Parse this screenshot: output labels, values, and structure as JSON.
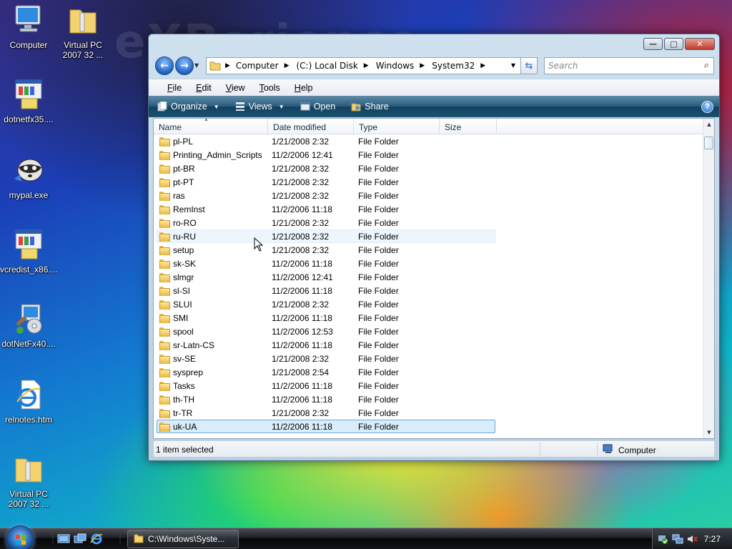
{
  "desktop": {
    "watermark": "eXPerience",
    "icons": [
      {
        "label": "Computer",
        "icon": "computer-icon"
      },
      {
        "label": "Virtual PC 2007 32 ...",
        "icon": "zip-folder-icon"
      },
      {
        "label": "dotnetfx35....",
        "icon": "installer-icon"
      },
      {
        "label": "mypal.exe",
        "icon": "raccoon-icon"
      },
      {
        "label": "vcredist_x86....",
        "icon": "installer-icon"
      },
      {
        "label": "dotNetFx40....",
        "icon": "setup-icon"
      },
      {
        "label": "relnotes.htm",
        "icon": "ie-document-icon"
      },
      {
        "label": "Virtual PC 2007 32 ...",
        "icon": "zip-folder-icon"
      }
    ]
  },
  "window": {
    "buttons": {
      "minimize": "—",
      "maximize": "□",
      "close": "✕"
    },
    "address": {
      "crumbs": [
        "Computer",
        "(C:) Local Disk",
        "Windows",
        "System32"
      ]
    },
    "search": {
      "placeholder": "Search"
    },
    "menu": [
      "File",
      "Edit",
      "View",
      "Tools",
      "Help"
    ],
    "toolbar": {
      "organize": "Organize",
      "views": "Views",
      "open": "Open",
      "share": "Share"
    },
    "columns": [
      "Name",
      "Date modified",
      "Type",
      "Size"
    ],
    "rows": [
      {
        "name": "pl-PL",
        "date": "1/21/2008 2:32",
        "type": "File Folder"
      },
      {
        "name": "Printing_Admin_Scripts",
        "date": "11/2/2006 12:41",
        "type": "File Folder"
      },
      {
        "name": "pt-BR",
        "date": "1/21/2008 2:32",
        "type": "File Folder"
      },
      {
        "name": "pt-PT",
        "date": "1/21/2008 2:32",
        "type": "File Folder"
      },
      {
        "name": "ras",
        "date": "1/21/2008 2:32",
        "type": "File Folder"
      },
      {
        "name": "RemInst",
        "date": "11/2/2006 11:18",
        "type": "File Folder"
      },
      {
        "name": "ro-RO",
        "date": "1/21/2008 2:32",
        "type": "File Folder"
      },
      {
        "name": "ru-RU",
        "date": "1/21/2008 2:32",
        "type": "File Folder",
        "state": "hover"
      },
      {
        "name": "setup",
        "date": "1/21/2008 2:32",
        "type": "File Folder"
      },
      {
        "name": "sk-SK",
        "date": "11/2/2006 11:18",
        "type": "File Folder"
      },
      {
        "name": "slmgr",
        "date": "11/2/2006 12:41",
        "type": "File Folder"
      },
      {
        "name": "sl-SI",
        "date": "11/2/2006 11:18",
        "type": "File Folder"
      },
      {
        "name": "SLUI",
        "date": "1/21/2008 2:32",
        "type": "File Folder"
      },
      {
        "name": "SMI",
        "date": "11/2/2006 11:18",
        "type": "File Folder"
      },
      {
        "name": "spool",
        "date": "11/2/2006 12:53",
        "type": "File Folder"
      },
      {
        "name": "sr-Latn-CS",
        "date": "11/2/2006 11:18",
        "type": "File Folder"
      },
      {
        "name": "sv-SE",
        "date": "1/21/2008 2:32",
        "type": "File Folder"
      },
      {
        "name": "sysprep",
        "date": "1/21/2008 2:54",
        "type": "File Folder"
      },
      {
        "name": "Tasks",
        "date": "11/2/2006 11:18",
        "type": "File Folder"
      },
      {
        "name": "th-TH",
        "date": "11/2/2006 11:18",
        "type": "File Folder"
      },
      {
        "name": "tr-TR",
        "date": "1/21/2008 2:32",
        "type": "File Folder"
      },
      {
        "name": "uk-UA",
        "date": "11/2/2006 11:18",
        "type": "File Folder",
        "state": "selected"
      }
    ],
    "status": {
      "selection": "1 item selected",
      "location": "Computer"
    }
  },
  "taskbar": {
    "task_label": "C:\\Windows\\Syste...",
    "clock": "7:27"
  },
  "colors": {
    "selection_fill": "#d8ecfb",
    "selection_border": "#6aa7d8",
    "command_bar": "#2b5d7e"
  }
}
